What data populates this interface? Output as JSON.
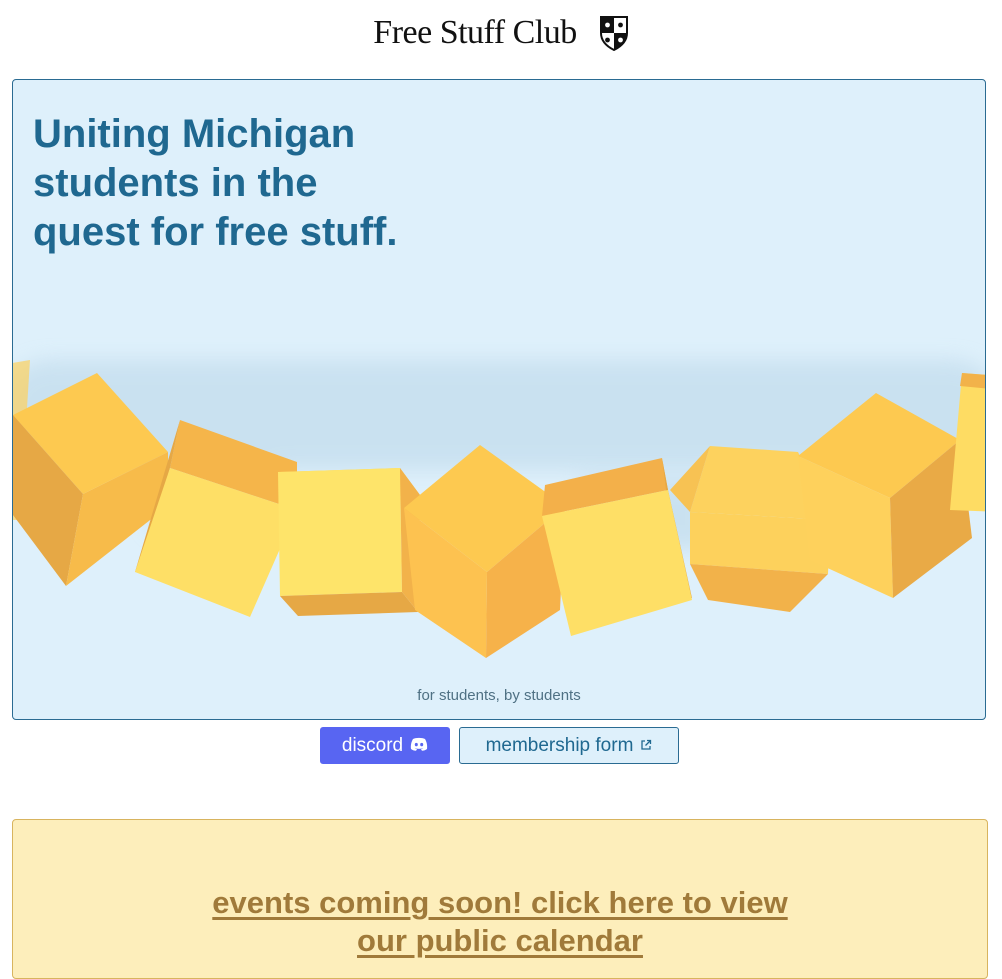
{
  "header": {
    "title": "Free Stuff Club",
    "crest_icon": "crest-shield-icon"
  },
  "hero": {
    "heading": "Uniting Michigan\nstudents in the\nquest for free stuff.",
    "tagline": "for students, by students",
    "background_color": "#def0fb",
    "heading_color": "#1f6890",
    "cube_color": "#fcc94f"
  },
  "actions": {
    "discord_label": "discord",
    "discord_icon": "discord-icon",
    "form_label": "membership form",
    "form_icon": "external-link-icon",
    "discord_color": "#5865f2"
  },
  "events": {
    "link_text": "events coming soon! click here to view our public calendar",
    "background_color": "#fdeebb"
  }
}
